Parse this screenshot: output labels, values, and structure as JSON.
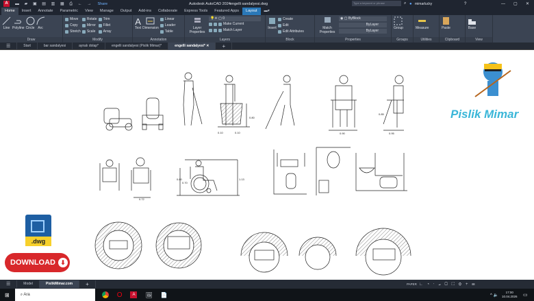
{
  "titlebar": {
    "app_title": "Autodesk AutoCAD 2024",
    "file_title": "engelli sandalyesi.dwg",
    "share": "Share",
    "search_placeholder": "Type a keyword or phrase",
    "user": "mimarlucky"
  },
  "ribbon_tabs": [
    "Home",
    "Insert",
    "Annotate",
    "Parametric",
    "View",
    "Manage",
    "Output",
    "Add-ins",
    "Collaborate",
    "Express Tools",
    "Featured Apps",
    "Layout"
  ],
  "ribbon": {
    "draw": {
      "title": "Draw",
      "items": [
        "Line",
        "Polyline",
        "Circle",
        "Arc"
      ]
    },
    "modify": {
      "title": "Modify",
      "items": [
        "Move",
        "Rotate",
        "Trim",
        "Copy",
        "Mirror",
        "Fillet",
        "Stretch",
        "Scale",
        "Array"
      ]
    },
    "annotation": {
      "title": "Annotation",
      "items": [
        "Text",
        "Dimension",
        "Linear",
        "Leader",
        "Table"
      ]
    },
    "layers": {
      "title": "Layers",
      "layer_props": "Layer Properties",
      "current_layer": "0",
      "make_current": "Make Current",
      "match_layer": "Match Layer"
    },
    "block": {
      "title": "Block",
      "insert": "Insert",
      "create": "Create",
      "edit": "Edit",
      "edit_attributes": "Edit Attributes"
    },
    "properties": {
      "title": "Properties",
      "match": "Match Properties",
      "color": "ByBlock",
      "linetype": "ByLayer",
      "lineweight": "ByLayer"
    },
    "groups": {
      "title": "Groups",
      "group": "Group"
    },
    "utilities": {
      "title": "Utilities",
      "measure": "Measure"
    },
    "clipboard": {
      "title": "Clipboard",
      "paste": "Paste"
    },
    "view": {
      "title": "View",
      "base": "Base"
    }
  },
  "file_tabs": [
    "Start",
    "bar sandalyesi",
    "aynalı dolap*",
    "engelli sandalyesi (Pislik Mimar)*",
    "engelli sandalyesi*"
  ],
  "drawing": {
    "dims": [
      "0.10",
      "0.80",
      "0.10",
      "0.90",
      "0.95",
      "0.85",
      "0.72",
      "1.13",
      "0.80",
      "0.70"
    ],
    "logo_text": "Pislik Mimar",
    "dwg_label": ".dwg",
    "download_label": "DOWNLOAD"
  },
  "layout_tabs": [
    "Model",
    "PislikMimar.com"
  ],
  "status": {
    "paper": "PAPER"
  },
  "taskbar": {
    "search": "Ara",
    "time": "17:00",
    "date": "10.04.2026"
  },
  "colors": {
    "accent": "#2a78b8",
    "ribbon": "#3b4453",
    "download": "#d8282b",
    "logo": "#3ab6d8"
  }
}
